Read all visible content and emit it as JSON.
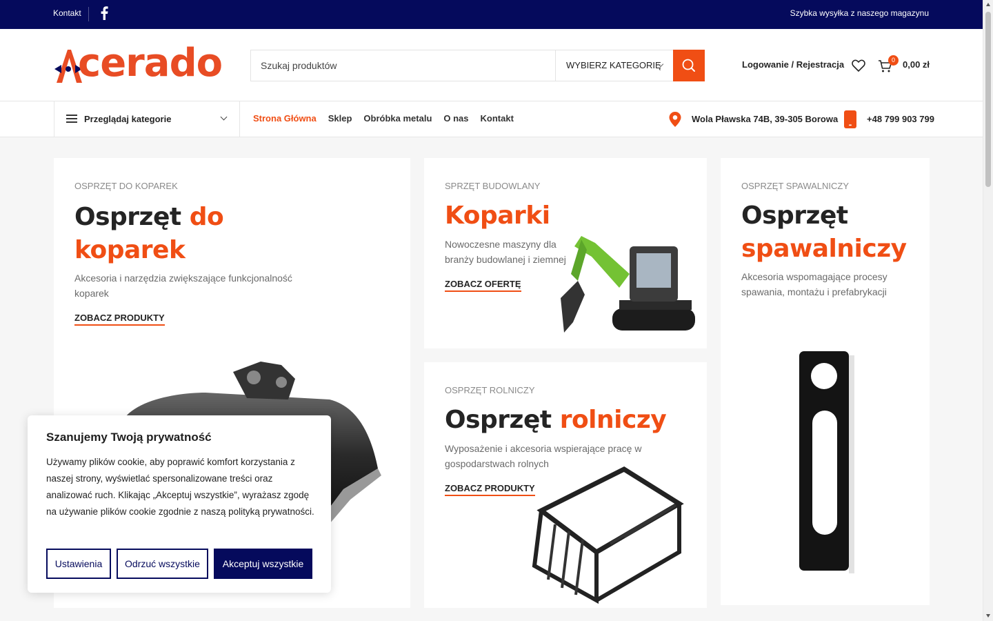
{
  "topbar": {
    "contact_label": "Kontakt",
    "facebook_icon": "facebook-icon",
    "shipping_text": "Szybka wysyłka z naszego magazynu"
  },
  "header": {
    "logo_text": "cerado",
    "search_placeholder": "Szukaj produktów",
    "category_select": "WYBIERZ KATEGORIĘ",
    "login_label": "Logowanie / Rejestracja",
    "cart_count": "0",
    "cart_total": "0,00 zł"
  },
  "nav": {
    "browse_categories": "Przeglądaj kategorie",
    "menu": [
      {
        "label": "Strona Główna",
        "active": true
      },
      {
        "label": "Sklep",
        "active": false
      },
      {
        "label": "Obróbka metalu",
        "active": false
      },
      {
        "label": "O nas",
        "active": false
      },
      {
        "label": "Kontakt",
        "active": false
      }
    ],
    "address": "Wola Pławska 74B, 39-305 Borowa",
    "phone": "+48 799 903 799"
  },
  "cards": [
    {
      "eyebrow": "OSPRZĘT DO KOPAREK",
      "title_plain": "Osprzęt",
      "title_accent": "do",
      "title_line2": "koparek",
      "description": "Akcesoria i narzędzia zwiększające funkcjonalność koparek",
      "cta": "ZOBACZ PRODUKTY"
    },
    {
      "eyebrow": "SPRZĘT BUDOWLANY",
      "title_accent": "Koparki",
      "description": "Nowoczesne maszyny dla branży budowlanej i ziemnej",
      "cta": "ZOBACZ OFERTĘ"
    },
    {
      "eyebrow": "OSPRZĘT ROLNICZY",
      "title_plain": "Osprzęt",
      "title_accent": "rolniczy",
      "description": "Wyposażenie i akcesoria wspierające pracę w gospodarstwach rolnych",
      "cta": "ZOBACZ PRODUKTY"
    },
    {
      "eyebrow": "OSPRZĘT SPAWALNICZY",
      "title_plain": "Osprzęt",
      "title_accent": "spawalniczy",
      "description": "Akcesoria wspomagające procesy spawania, montażu i prefabrykacji"
    }
  ],
  "cookie": {
    "title": "Szanujemy Twoją prywatność",
    "text": "Używamy plików cookie, aby poprawić komfort korzystania z naszej strony, wyświetlać spersonalizowane treści oraz analizować ruch. Klikając „Akceptuj wszystkie”, wyrażasz zgodę na używanie plików cookie zgodnie z naszą polityką prywatności.",
    "settings": "Ustawienia",
    "reject": "Odrzuć wszystkie",
    "accept": "Akceptuj wszystkie"
  },
  "colors": {
    "navy": "#050a5c",
    "accent": "#f04e14"
  }
}
